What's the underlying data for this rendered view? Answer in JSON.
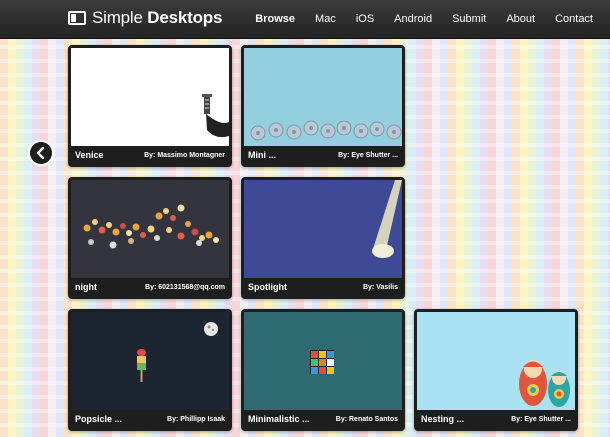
{
  "header": {
    "logo_regular": "Simple",
    "logo_bold": "Desktops",
    "nav": [
      "Browse",
      "Mac",
      "iOS",
      "Android",
      "Submit",
      "About",
      "Contact"
    ]
  },
  "icons": {
    "logo": "monitor-icon",
    "back": "chevron-left-icon"
  },
  "cards": [
    {
      "title": "Venice",
      "by": "By: Massimo Montagner"
    },
    {
      "title": "Mini ...",
      "by": "By: Eye Shutter ..."
    },
    {
      "title": "night",
      "by": "By: 602131568@qq.com"
    },
    {
      "title": "Spotlight",
      "by": "By: Vasilis"
    },
    {
      "title": "Popsicle ...",
      "by": "By: Phillipp Isaak"
    },
    {
      "title": "Minimalistic ...",
      "by": "By: Renato Santos"
    },
    {
      "title": "Nesting ...",
      "by": "By: Eye Shutter ..."
    }
  ],
  "colors": {
    "header_bg": "#2b2b2b",
    "card_frame": "#1e1e1e",
    "venice_bg": "#ffffff",
    "mini_bg": "#93cfdf",
    "night_bg": "#33343d",
    "spotlight_bg": "#3f4a96",
    "popsicle_bg": "#1d2533",
    "minimalistic_bg": "#2d6a71",
    "nesting_bg": "#a9e2f0"
  }
}
